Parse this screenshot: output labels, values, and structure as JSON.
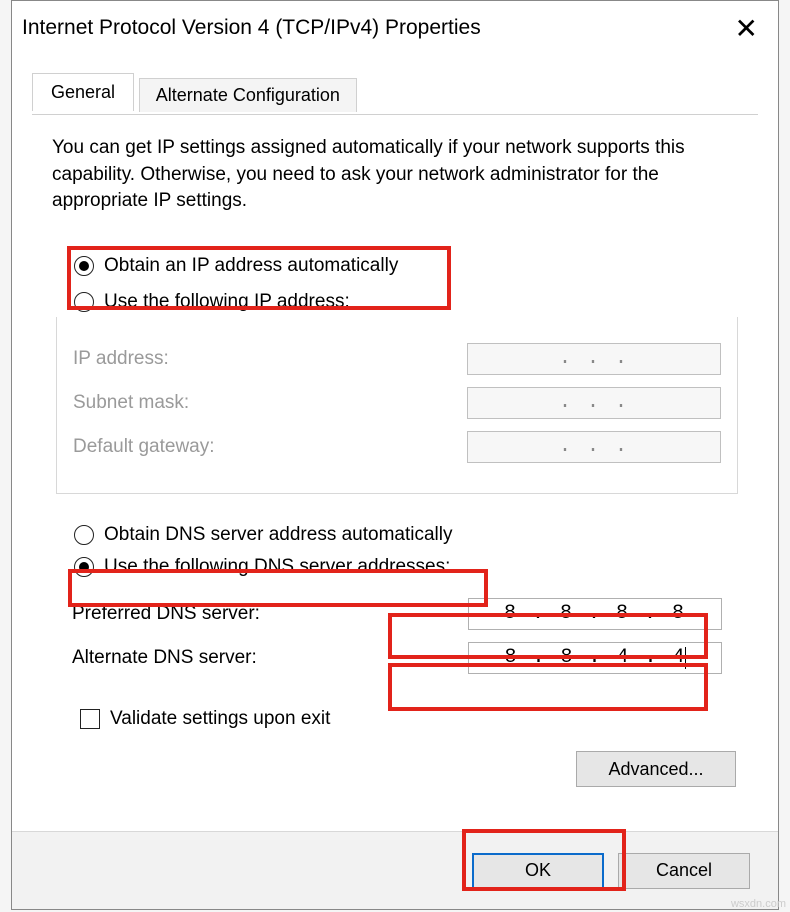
{
  "window": {
    "title": "Internet Protocol Version 4 (TCP/IPv4) Properties"
  },
  "tabs": {
    "general": "General",
    "alt": "Alternate Configuration"
  },
  "intro": "You can get IP settings assigned automatically if your network supports this capability. Otherwise, you need to ask your network administrator for the appropriate IP settings.",
  "ip": {
    "auto_label": "Obtain an IP address automatically",
    "manual_label": "Use the following IP address:",
    "fields": {
      "ip_label": "IP address:",
      "subnet_label": "Subnet mask:",
      "gateway_label": "Default gateway:"
    },
    "placeholder_dots": ".       .       ."
  },
  "dns": {
    "auto_label": "Obtain DNS server address automatically",
    "manual_label": "Use the following DNS server addresses:",
    "preferred_label": "Preferred DNS server:",
    "alternate_label": "Alternate DNS server:",
    "preferred_value": "8 . 8 . 8 . 8",
    "alternate_value": "8 . 8 . 4 . 4"
  },
  "validate_label": "Validate settings upon exit",
  "buttons": {
    "advanced": "Advanced...",
    "ok": "OK",
    "cancel": "Cancel"
  },
  "watermark": "wsxdn.com"
}
